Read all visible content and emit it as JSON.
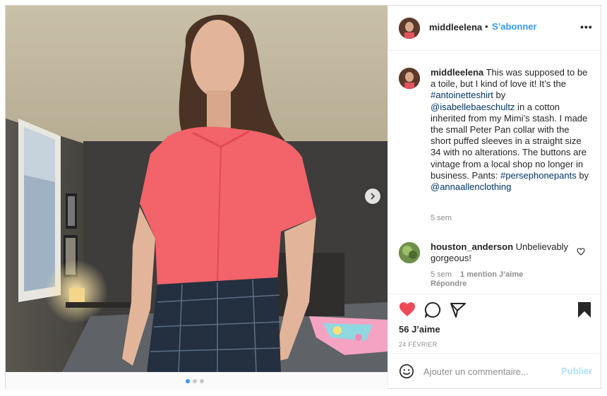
{
  "post": {
    "username": "middleelena",
    "separator": "•",
    "follow_label": "S’abonner",
    "more_label": "•••"
  },
  "caption": {
    "username": "middleelena",
    "text_1": " This was supposed to be a toile, but I kind of love it! It’s the ",
    "hashtag_1": "#antoinetteshirt",
    "text_2": " by ",
    "mention_1": "@isabellebaeschultz",
    "text_3": " in a cotton inherited from my Mimi’s stash. I made the small Peter Pan collar with the short puffed sleeves in a straight size 34 with no alterations. The buttons are vintage from a local shop no longer in business. Pants: ",
    "hashtag_2": "#persephonepants",
    "text_4": " by ",
    "mention_2": "@annaallenclothing",
    "time": "5 sem"
  },
  "comment": {
    "username": "houston_anderson",
    "text": " Unbelievably gorgeous!",
    "time": "5 sem",
    "likes": "1 mention J’aime",
    "reply_label": "Répondre"
  },
  "actions": {
    "likes_count": "56 J’aime",
    "date": "24 FÉVRIER",
    "liked": true
  },
  "add_comment": {
    "placeholder": "Ajouter un commentaire...",
    "publish_label": "Publier"
  },
  "carousel": {
    "current": 1,
    "total": 3
  },
  "colors": {
    "accent": "#3897f0",
    "like_red": "#ed4956",
    "link": "#00376b",
    "muted": "#8e8e8e",
    "publish_disabled": "#b2dffc"
  },
  "icons": {
    "next": "chevron-right-icon",
    "like": "heart-icon",
    "comment": "comment-bubble-icon",
    "share": "paper-plane-icon",
    "save": "bookmark-icon",
    "emoji": "smiley-icon",
    "more": "more-dots-icon"
  }
}
